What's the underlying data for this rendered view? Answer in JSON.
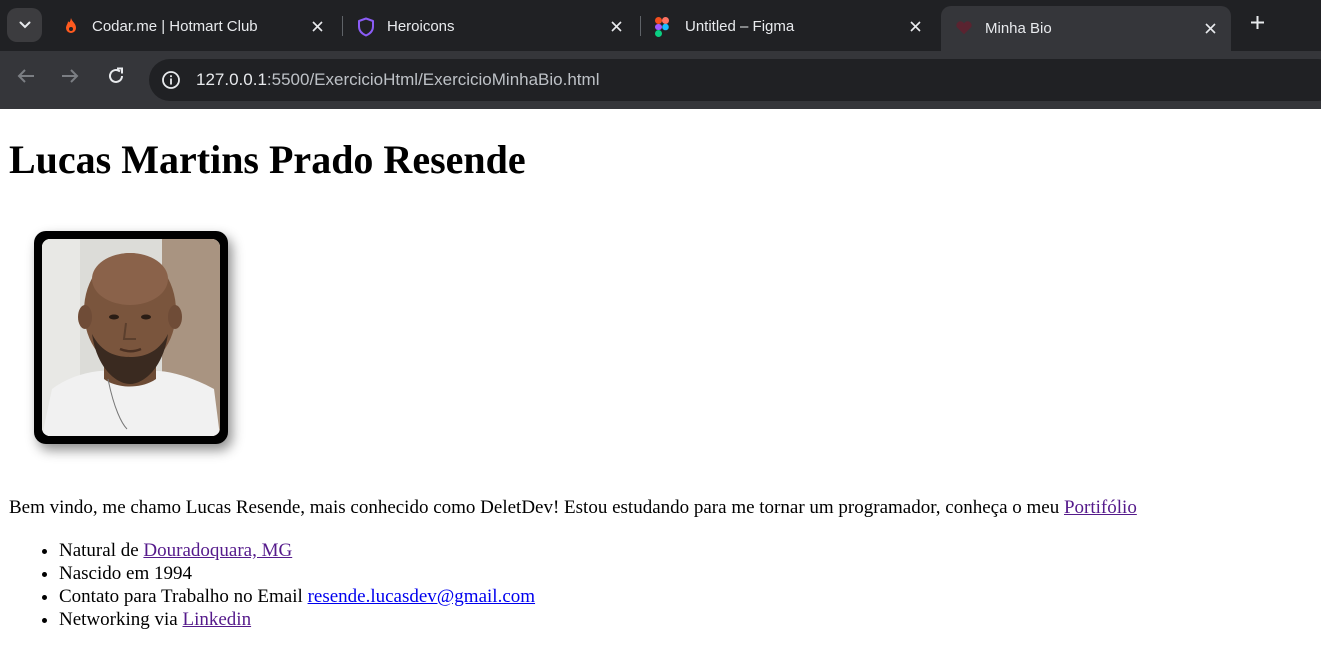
{
  "browser": {
    "tabs": [
      {
        "title": "Codar.me | Hotmart Club",
        "icon": "flame-icon",
        "active": false
      },
      {
        "title": "Heroicons",
        "icon": "shield-icon",
        "active": false
      },
      {
        "title": "Untitled – Figma",
        "icon": "figma-icon",
        "active": false
      },
      {
        "title": "Minha Bio",
        "icon": "heart-icon",
        "active": true
      }
    ],
    "url": {
      "host": "127.0.0.1",
      "path": ":5500/ExercicioHtml/ExercicioMinhaBio.html"
    },
    "colors": {
      "tabbar": "#202124",
      "toolbar": "#35363a",
      "heroicons": "#8b5cf6",
      "codar": "#ff5a1f"
    }
  },
  "page": {
    "title": "Lucas Martins Prado Resende",
    "intro": {
      "text": "Bem vindo, me chamo Lucas Resende, mais conhecido como DeletDev! Estou estudando para me tornar um programador, conheça o meu ",
      "link": "Portifólio"
    },
    "facts": [
      {
        "prefix": "Natural de ",
        "link": "Douradoquara, MG"
      },
      {
        "prefix": "Nascido em 1994",
        "link": ""
      },
      {
        "prefix": "Contato para Trabalho no Email ",
        "link": "resende.lucasdev@gmail.com"
      },
      {
        "prefix": "Networking via ",
        "link": "Linkedin"
      }
    ],
    "colors": {
      "visited_link": "#551a8b",
      "link": "#0000ee"
    }
  }
}
